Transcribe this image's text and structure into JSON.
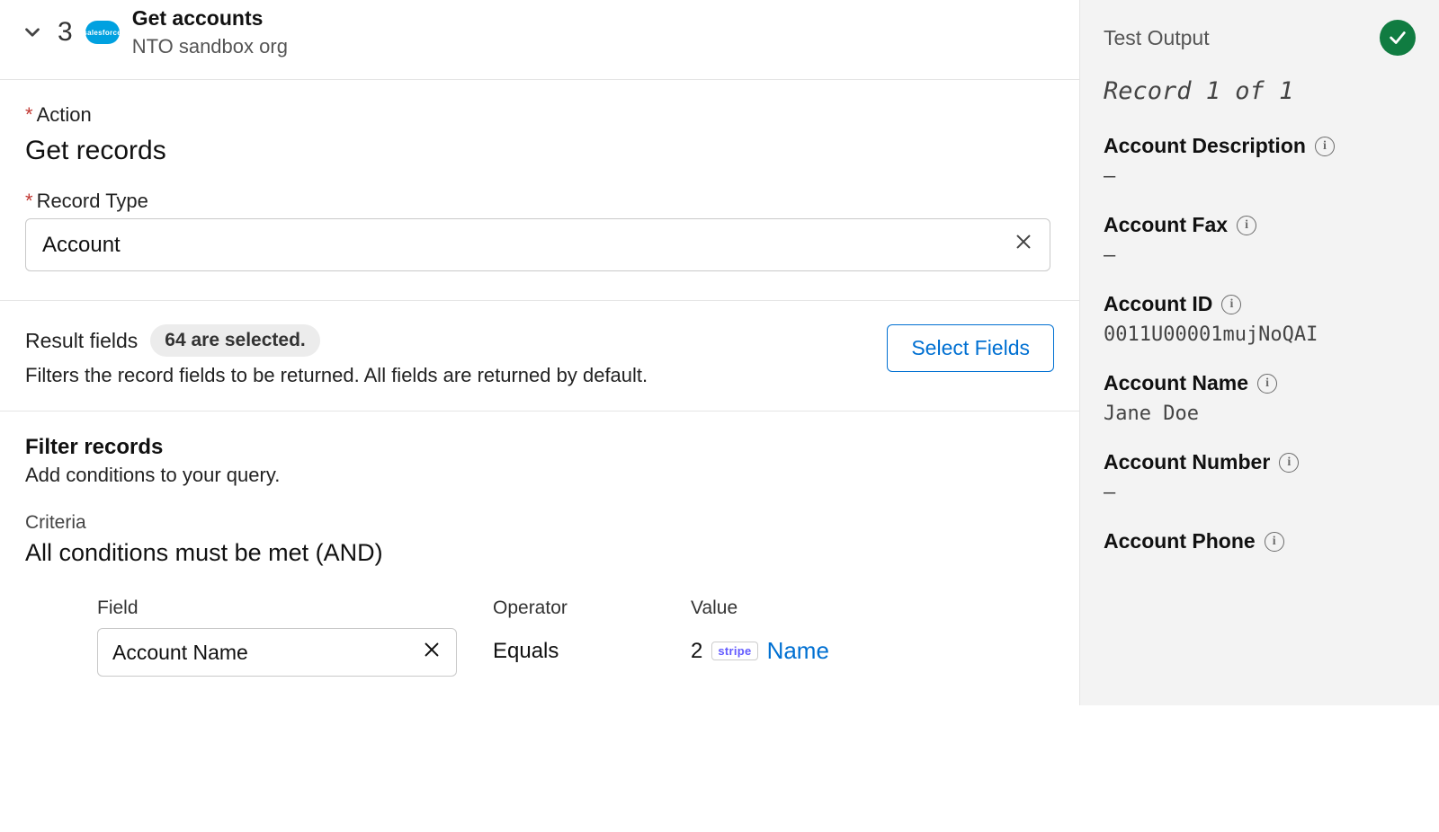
{
  "header": {
    "step_number": "3",
    "title": "Get accounts",
    "subtitle": "NTO sandbox org",
    "cloud_text": "salesforce"
  },
  "action": {
    "label": "Action",
    "value": "Get records"
  },
  "record_type": {
    "label": "Record Type",
    "value": "Account"
  },
  "result_fields": {
    "title": "Result fields",
    "pill": "64 are selected.",
    "desc": "Filters the record fields to be returned. All fields are returned by default.",
    "button": "Select Fields"
  },
  "filter": {
    "title": "Filter records",
    "desc": "Add conditions to your query.",
    "criteria_label": "Criteria",
    "criteria_value": "All conditions must be met (AND)",
    "columns": {
      "field": "Field",
      "operator": "Operator",
      "value": "Value"
    },
    "row": {
      "field": "Account Name",
      "operator": "Equals",
      "value_step": "2",
      "value_tag": "stripe",
      "value_name": "Name"
    }
  },
  "test_output": {
    "title": "Test Output",
    "record_line": "Record 1 of 1",
    "fields": [
      {
        "label": "Account Description",
        "value": "–"
      },
      {
        "label": "Account Fax",
        "value": "–"
      },
      {
        "label": "Account ID",
        "value": "0011U00001mujNoQAI"
      },
      {
        "label": "Account Name",
        "value": "Jane Doe"
      },
      {
        "label": "Account Number",
        "value": "–"
      },
      {
        "label": "Account Phone",
        "value": ""
      }
    ]
  }
}
